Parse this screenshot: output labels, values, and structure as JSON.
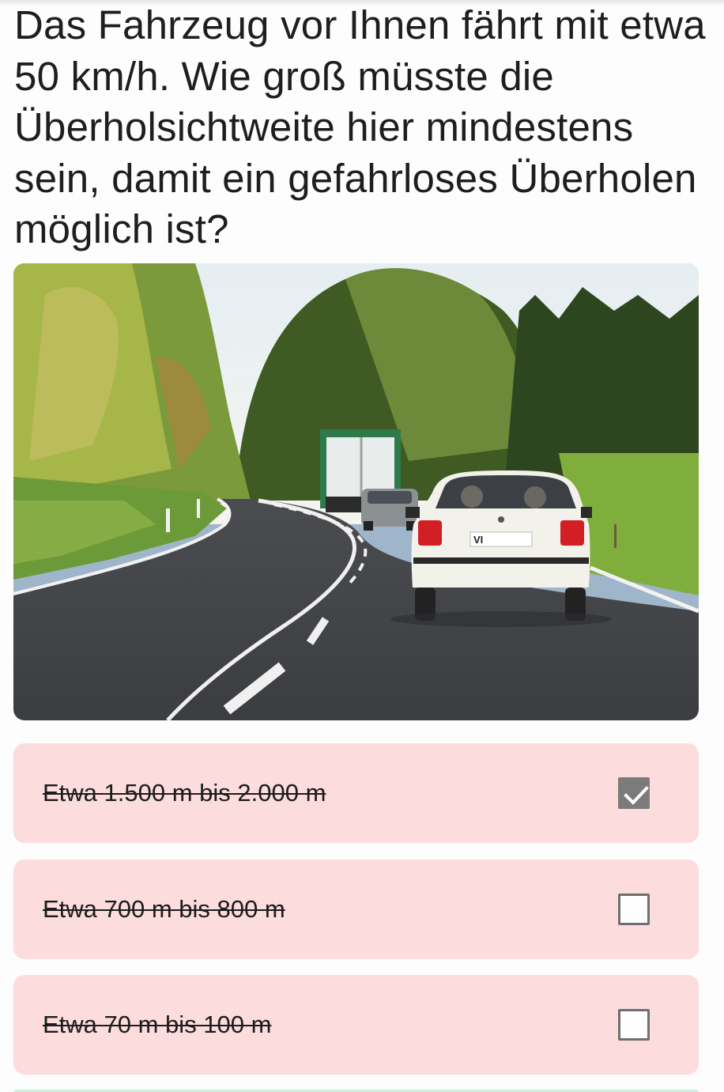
{
  "question": {
    "text": "Das Fahrzeug vor Ihnen fährt mit etwa 50 km/h. Wie groß müsste die Überholsichtweite hier mindestens sein, damit ein gefahrloses Überholen möglich ist?"
  },
  "image": {
    "icon": "road-scene-photo",
    "car_plate": "VI"
  },
  "answers": [
    {
      "label": "Etwa 1.500 m bis 2.000 m",
      "checked": true
    },
    {
      "label": "Etwa 700 m bis 800 m",
      "checked": false
    },
    {
      "label": "Etwa 70 m bis 100 m",
      "checked": false
    }
  ],
  "colors": {
    "answer_background": "#fcdcdc",
    "checkbox_checked": "#7b7b7b",
    "next_card": "#cdeee0"
  }
}
